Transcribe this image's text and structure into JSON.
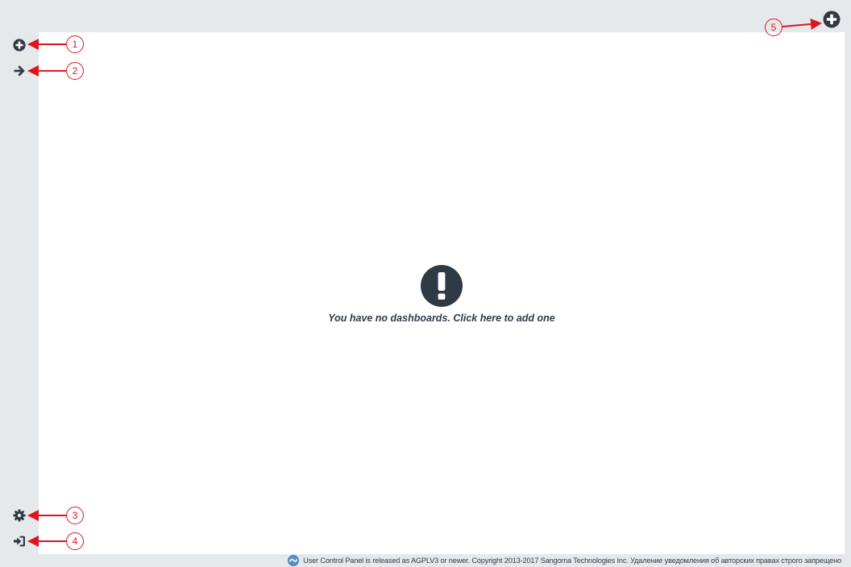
{
  "main": {
    "empty_text": "You have no dashboards. Click here to add one"
  },
  "sidebar": {
    "items": [
      {
        "icon": "plus-circle-icon",
        "label": ""
      },
      {
        "icon": "arrow-right-icon",
        "label": ""
      },
      {
        "icon": "gear-icon",
        "label": ""
      },
      {
        "icon": "sign-out-icon",
        "label": ""
      }
    ]
  },
  "topbar": {
    "add_icon": "plus-circle-icon"
  },
  "footer": {
    "text": "User Control Panel is released as AGPLV3 or newer. Copyright 2013-2017 Sangoma Technologies Inc. Удаление уведомления об авторских правах строго запрещено"
  },
  "callouts": [
    "1",
    "2",
    "3",
    "4",
    "5"
  ],
  "colors": {
    "icon": "#2f3a45",
    "annotation": "#e0141e",
    "background": "#e6e9ec",
    "panel": "#ffffff"
  }
}
